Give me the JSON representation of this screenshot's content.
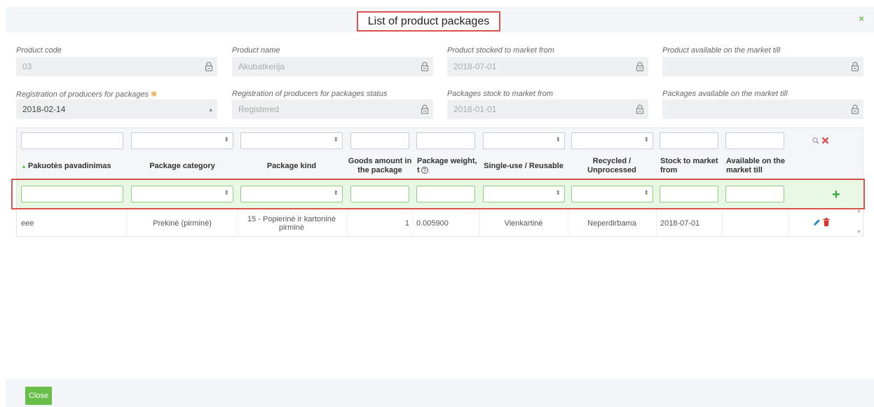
{
  "modal": {
    "title": "List of product packages",
    "close_symbol": "×"
  },
  "fields_row1": [
    {
      "label": "Product code",
      "value": "03"
    },
    {
      "label": "Product name",
      "value": "Akubatkerija"
    },
    {
      "label": "Product stocked to market from",
      "value": "2018-07-01"
    },
    {
      "label": "Product available on the market till",
      "value": ""
    }
  ],
  "fields_row2": [
    {
      "label": "Registration of producers for packages",
      "required_mark": "✱",
      "value": "2018-02-14"
    },
    {
      "label": "Registration of producers for packages status",
      "value": "Registered"
    },
    {
      "label": "Packages stock to market from",
      "value": "2018-01-01"
    },
    {
      "label": "Packages available on the market till",
      "value": ""
    }
  ],
  "table": {
    "headers": {
      "name": "Pakuotės pavadinimas",
      "category": "Package category",
      "kind": "Package kind",
      "goods_amount": "Goods amount in the package",
      "weight": "Package weight, t",
      "single_use": "Single-use / Reusable",
      "recycled": "Recycled / Unprocessed",
      "stock_from": "Stock to market from",
      "available_till": "Available on the market till"
    },
    "sort_indicator": "▲",
    "help_symbol": "?",
    "add_symbol": "+",
    "rows": [
      {
        "name": "eee",
        "category": "Prekinė (pirminė)",
        "kind": "15 - Popierinė ir kartoninė pirminė",
        "goods_amount": "1",
        "weight": "0.005900",
        "single_use": "Vienkartinė",
        "recycled": "Neperdirbama",
        "stock_from": "2018-07-01",
        "available_till": ""
      }
    ]
  },
  "footer": {
    "close_label": "Close"
  },
  "colors": {
    "accent_green": "#6abf4b",
    "highlight_red": "#d9534f",
    "new_row_bg": "#e9f8e5"
  }
}
